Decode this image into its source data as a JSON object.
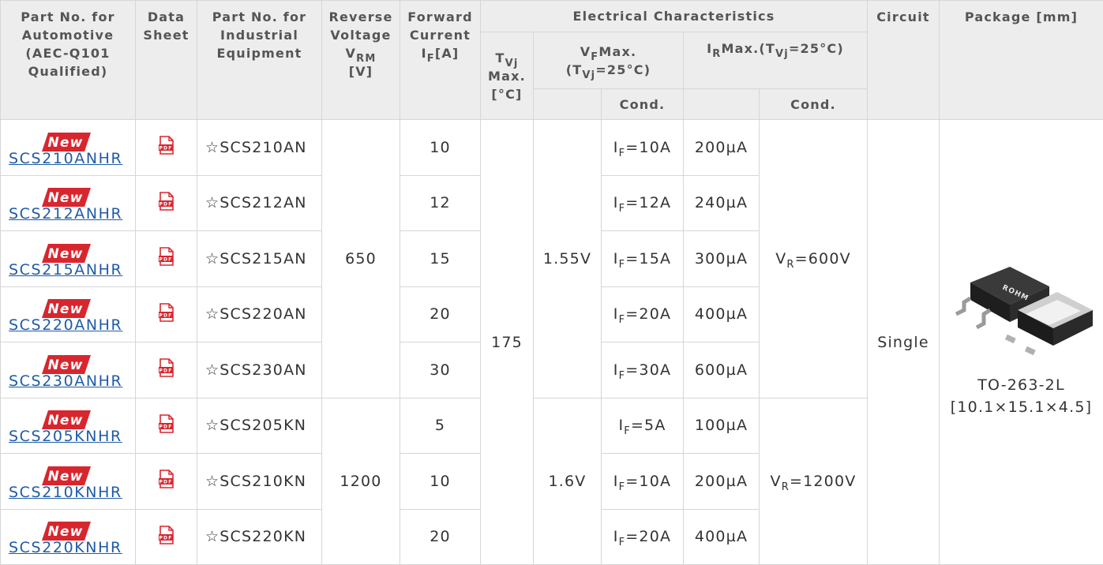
{
  "headers": {
    "part_auto": "Part No. for Automotive (AEC-Q101 Qualified)",
    "datasheet": "Data Sheet",
    "part_ind": "Part No. for Industrial Equipment",
    "rev_voltage": "Reverse Voltage",
    "rev_voltage_sym": "V",
    "rev_voltage_sub": "RM",
    "rev_voltage_unit": "[V]",
    "fwd_current": "Forward Current",
    "fwd_current_sym": "I",
    "fwd_current_sub": "F",
    "fwd_current_unit": "[A]",
    "electrical": "Electrical Characteristics",
    "tvj_sym": "T",
    "tvj_sub": "Vj",
    "tvj_rest": "Max. [°C]",
    "vf_sym": "V",
    "vf_sub": "F",
    "vf_max": "Max.",
    "vf_cond_open": "(T",
    "vf_cond_sub": "Vj",
    "vf_cond_close": "=25°C)",
    "ir_sym": "I",
    "ir_sub": "R",
    "ir_rest": "Max.(T",
    "ir_sub2": "Vj",
    "ir_close": "=25°C)",
    "cond": "Cond.",
    "circuit": "Circuit",
    "package": "Package [mm]"
  },
  "icons": {
    "new_badge": "new-badge-icon",
    "datasheet": "pdf-icon",
    "star": "☆"
  },
  "colors": {
    "link": "#1f5ba6",
    "badge": "#d8262e",
    "pdf": "#d8262e",
    "header_bg": "#ededed",
    "border": "#d6d6d6"
  },
  "new_label": "New",
  "pdf_label": "PDF",
  "rows": [
    {
      "auto": "SCS210ANHR",
      "ind": "SCS210AN",
      "current": "10",
      "cond_sym": "I",
      "cond_sub": "F",
      "cond_val": "=10A",
      "ir": "200µA"
    },
    {
      "auto": "SCS212ANHR",
      "ind": "SCS212AN",
      "current": "12",
      "cond_sym": "I",
      "cond_sub": "F",
      "cond_val": "=12A",
      "ir": "240µA"
    },
    {
      "auto": "SCS215ANHR",
      "ind": "SCS215AN",
      "current": "15",
      "cond_sym": "I",
      "cond_sub": "F",
      "cond_val": "=15A",
      "ir": "300µA"
    },
    {
      "auto": "SCS220ANHR",
      "ind": "SCS220AN",
      "current": "20",
      "cond_sym": "I",
      "cond_sub": "F",
      "cond_val": "=20A",
      "ir": "400µA"
    },
    {
      "auto": "SCS230ANHR",
      "ind": "SCS230AN",
      "current": "30",
      "cond_sym": "I",
      "cond_sub": "F",
      "cond_val": "=30A",
      "ir": "600µA"
    },
    {
      "auto": "SCS205KNHR",
      "ind": "SCS205KN",
      "current": "5",
      "cond_sym": "I",
      "cond_sub": "F",
      "cond_val": "=5A",
      "ir": "100µA"
    },
    {
      "auto": "SCS210KNHR",
      "ind": "SCS210KN",
      "current": "10",
      "cond_sym": "I",
      "cond_sub": "F",
      "cond_val": "=10A",
      "ir": "200µA"
    },
    {
      "auto": "SCS220KNHR",
      "ind": "SCS220KN",
      "current": "20",
      "cond_sym": "I",
      "cond_sub": "F",
      "cond_val": "=20A",
      "ir": "400µA"
    }
  ],
  "groups": {
    "voltage_650": "650",
    "voltage_1200": "1200",
    "tvj": "175",
    "vf_155": "1.55V",
    "vf_16": "1.6V",
    "vr_600_sym": "V",
    "vr_600_sub": "R",
    "vr_600_val": "=600V",
    "vr_1200_sym": "V",
    "vr_1200_sub": "R",
    "vr_1200_val": "=1200V",
    "circuit": "Single",
    "package_name": "TO-263-2L",
    "package_dim": "[10.1×15.1×4.5]",
    "package_brand": "ROHM"
  }
}
